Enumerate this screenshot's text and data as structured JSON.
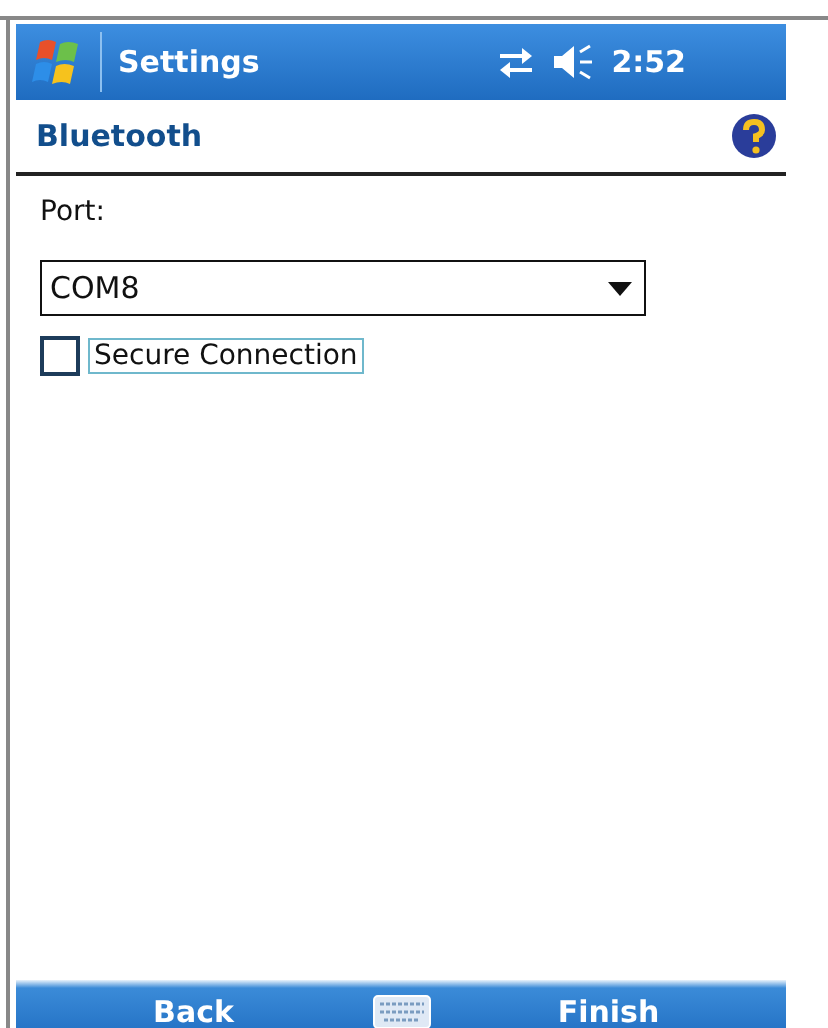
{
  "title_bar": {
    "title": "Settings",
    "time": "2:52"
  },
  "header": {
    "title": "Bluetooth"
  },
  "port": {
    "label": "Port:",
    "value": "COM8"
  },
  "secure_connection": {
    "label": "Secure Connection",
    "checked": false
  },
  "softkeys": [
    "Back",
    "Finish"
  ]
}
